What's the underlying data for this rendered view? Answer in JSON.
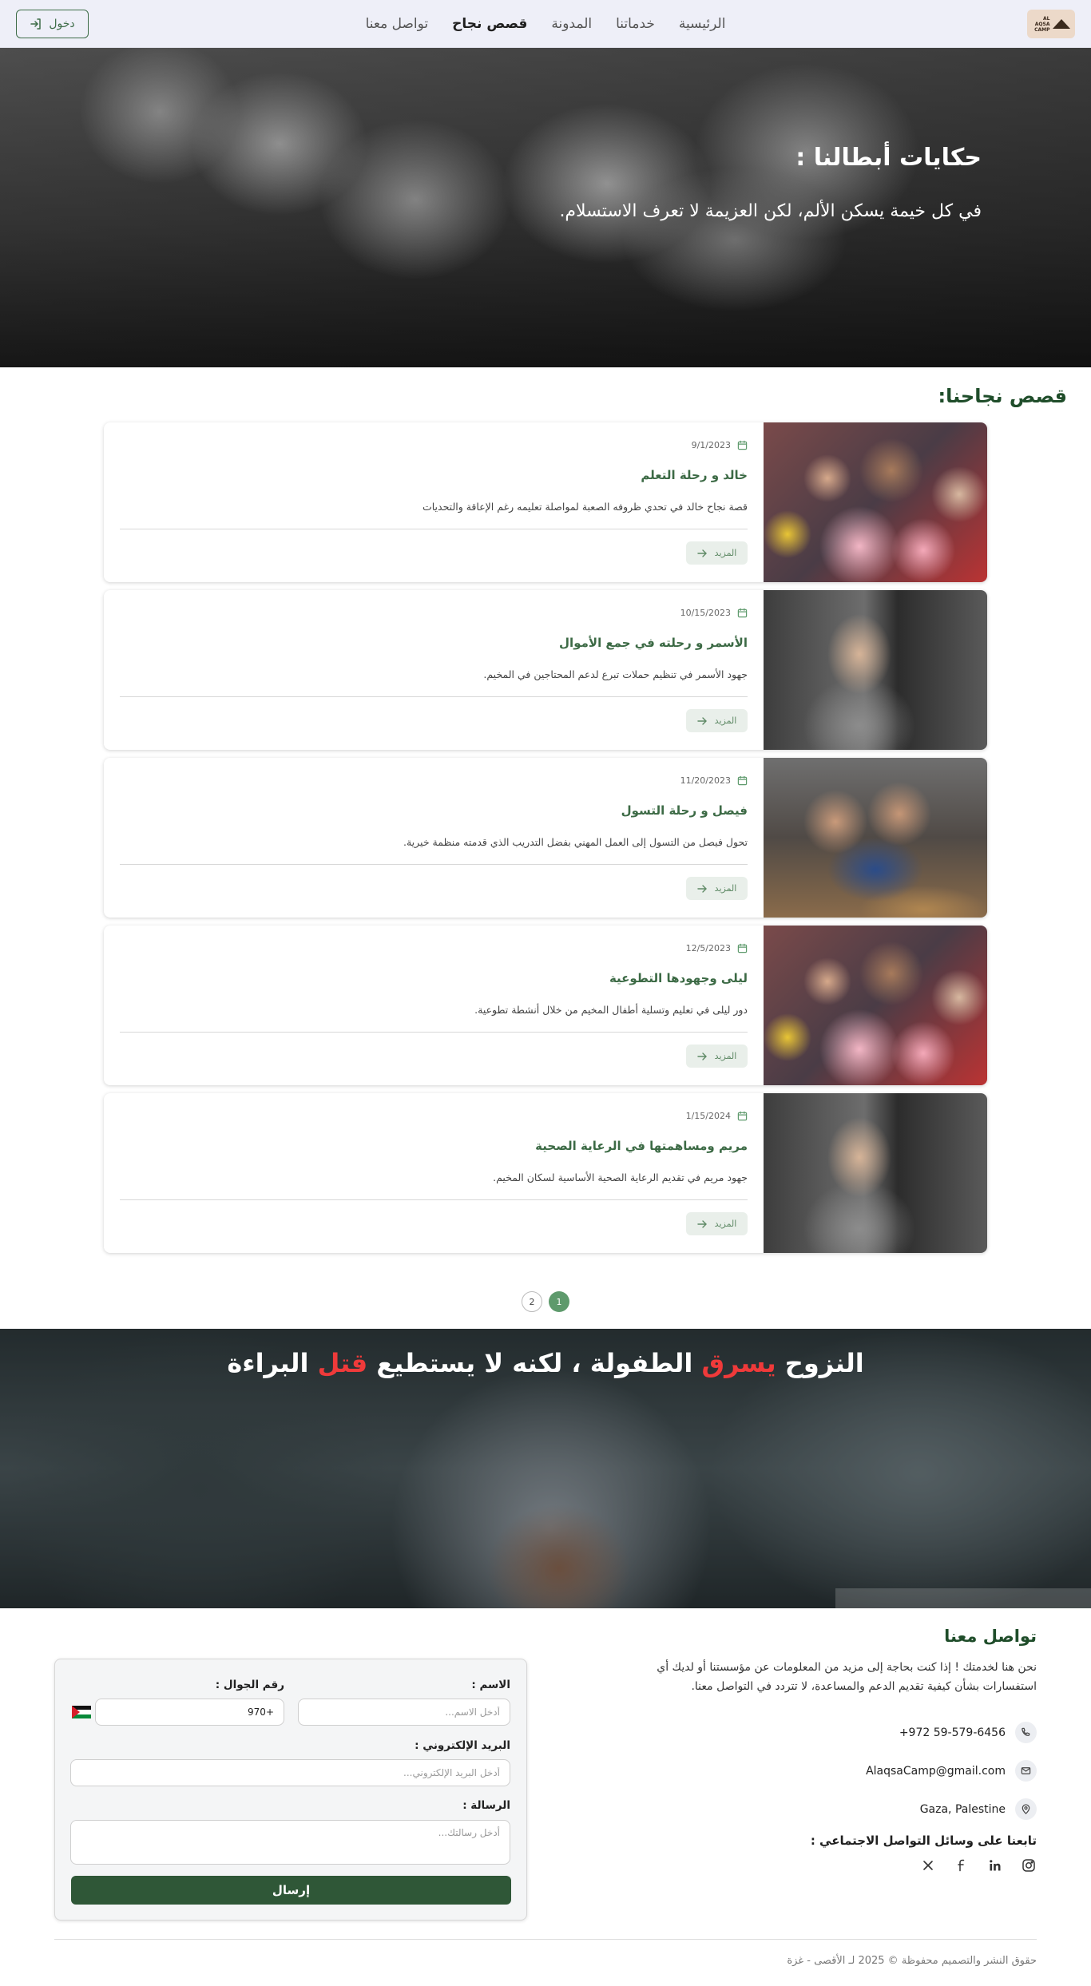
{
  "nav": {
    "logo_text": "AL AQSA CAMP",
    "links": [
      "الرئيسية",
      "خدماتنا",
      "المدونة",
      "قصص نجاح",
      "تواصل معنا"
    ],
    "active_index": 3,
    "login_label": "دخول"
  },
  "hero": {
    "title": "حكايات أبطالنا :",
    "subtitle": "في كل خيمة يسكن الألم، لكن العزيمة لا تعرف الاستسلام."
  },
  "stories": {
    "section_title": "قصص نجاحنا:",
    "more_label": "المزيد",
    "items": [
      {
        "date": "9/1/2023",
        "title": "خالد و رحلة التعلم",
        "desc": "قصة نجاح خالد في تحدي ظروفه الصعبة لمواصلة تعليمه رغم الإعاقة والتحديات",
        "image": "children-with-teddy-bears"
      },
      {
        "date": "10/15/2023",
        "title": "الأسمر و رحلته في جمع الأموال",
        "desc": "جهود الأسمر في تنظيم حملات تبرع لدعم المحتاجين في المخيم.",
        "image": "child-waving"
      },
      {
        "date": "11/20/2023",
        "title": "فيصل و رحلة التسول",
        "desc": "تحول فيصل من التسول إلى العمل المهني بفضل التدريب الذي قدمته منظمة خيرية.",
        "image": "children-sitting"
      },
      {
        "date": "12/5/2023",
        "title": "ليلى وجهودها التطوعية",
        "desc": "دور ليلى في تعليم وتسلية أطفال المخيم من خلال أنشطة تطوعية.",
        "image": "children-with-teddy-bears"
      },
      {
        "date": "1/15/2024",
        "title": "مريم ومساهمتها في الرعاية الصحية",
        "desc": "جهود مريم في تقديم الرعاية الصحية الأساسية لسكان المخيم.",
        "image": "child-waving"
      }
    ]
  },
  "pagination": {
    "pages": [
      "1",
      "2"
    ],
    "current": "1"
  },
  "banner": {
    "part1": "النزوح ",
    "red1": "يسرق",
    "part2": " الطفولة ، لكنه لا يستطيع ",
    "red2": "قتل",
    "part3": " البراءة"
  },
  "contact": {
    "title": "تواصل معنا",
    "description": "نحن هنا لخدمتك ! إذا كنت بحاجة إلى مزيد من المعلومات عن مؤسستنا أو لديك أي استفسارات بشأن كيفية تقديم الدعم والمساعدة، لا تتردد في التواصل معنا.",
    "phone": "+972 59-579-6456",
    "email": "AlaqsaCamp@gmail.com",
    "location": "Gaza, Palestine",
    "social_title": "تابعنا على وسائل التواصل الاجتماعي :",
    "socials": [
      "instagram-icon",
      "linkedin-icon",
      "facebook-icon",
      "x-icon"
    ]
  },
  "form": {
    "name_label": "الاسم :",
    "name_placeholder": "أدخل الاسم...",
    "phone_label": "رقم الجوال :",
    "phone_value": "+970",
    "email_label": "البريد الإلكتروني :",
    "email_placeholder": "أدخل البريد الإلكتروني...",
    "message_label": "الرسالة :",
    "message_placeholder": "أدخل رسالتك...",
    "submit_label": "إرسال"
  },
  "footer": {
    "copyright": "حقوق النشر والتصميم محفوظة © 2025 لـ الأقصى - غزة"
  },
  "colors": {
    "brand_green": "#2f5737",
    "accent_green": "#3c6a45",
    "accent_red": "#ef3a3a"
  }
}
